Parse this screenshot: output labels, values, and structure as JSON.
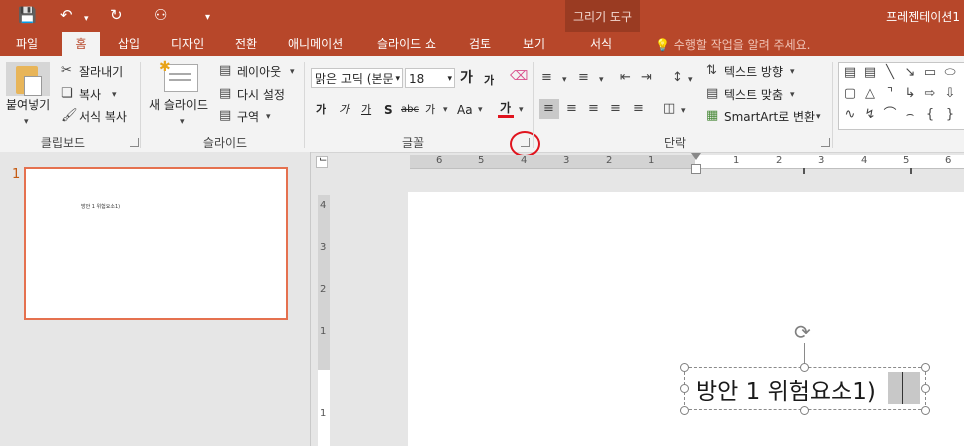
{
  "window": {
    "title": "프레젠테이션1",
    "drawing_tools_label": "그리기 도구"
  },
  "quick_access": {
    "save_icon": "save-icon",
    "undo_icon": "undo-icon",
    "redo_icon": "redo-icon",
    "present_icon": "present-icon",
    "customize_icon": "customize-icon"
  },
  "tabs": [
    {
      "label": "파일"
    },
    {
      "label": "홈"
    },
    {
      "label": "삽입"
    },
    {
      "label": "디자인"
    },
    {
      "label": "전환"
    },
    {
      "label": "애니메이션"
    },
    {
      "label": "슬라이드 쇼"
    },
    {
      "label": "검토"
    },
    {
      "label": "보기"
    },
    {
      "label": "서식"
    }
  ],
  "tell_me": "수행할 작업을 알려 주세요.",
  "clipboard": {
    "paste": "붙여넣기",
    "cut": "잘라내기",
    "copy": "복사",
    "format_painter": "서식 복사",
    "group": "클립보드"
  },
  "slides_group": {
    "new_slide": "새 슬라이드",
    "layout": "레이아웃",
    "reset": "다시 설정",
    "section": "구역",
    "group": "슬라이드"
  },
  "font_group": {
    "font_name": "맑은 고딕 (본문)",
    "font_size": "18",
    "grow": "가",
    "shrink": "가",
    "bold": "가",
    "italic": "가",
    "underline": "가",
    "shadow": "S",
    "strike": "abc",
    "spacing": "가",
    "case": "Aa",
    "font_color": "가",
    "group": "글꼴"
  },
  "paragraph_group": {
    "text_direction": "텍스트 방향",
    "align_text": "텍스트 맞춤",
    "smartart": "SmartArt로 변환",
    "group": "단락"
  },
  "ruler": {
    "h_numbers": [
      "6",
      "5",
      "4",
      "3",
      "2",
      "1",
      "1",
      "2",
      "3",
      "4",
      "5",
      "6"
    ],
    "v_numbers": [
      "4",
      "3",
      "2",
      "1",
      "1"
    ]
  },
  "thumbnail": {
    "number": "1",
    "text": "방안 1 위험요소1)"
  },
  "slide": {
    "textbox_main": "방안 1 위험요소",
    "textbox_selected": "1)"
  },
  "colors": {
    "accent": "#b7472a",
    "ribbon": "#f3f3f3",
    "annotation": "#e0141e"
  }
}
